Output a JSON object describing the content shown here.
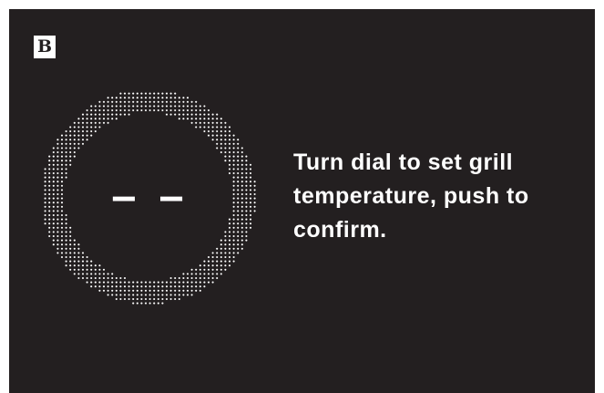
{
  "screen": {
    "background": "#231f20",
    "foreground": "#ffffff"
  },
  "badge": {
    "label": "B"
  },
  "dial": {
    "value": "– –",
    "icon": "dotted-ring-dial"
  },
  "instruction": {
    "text": "Turn dial to set grill temperature, push to confirm."
  }
}
